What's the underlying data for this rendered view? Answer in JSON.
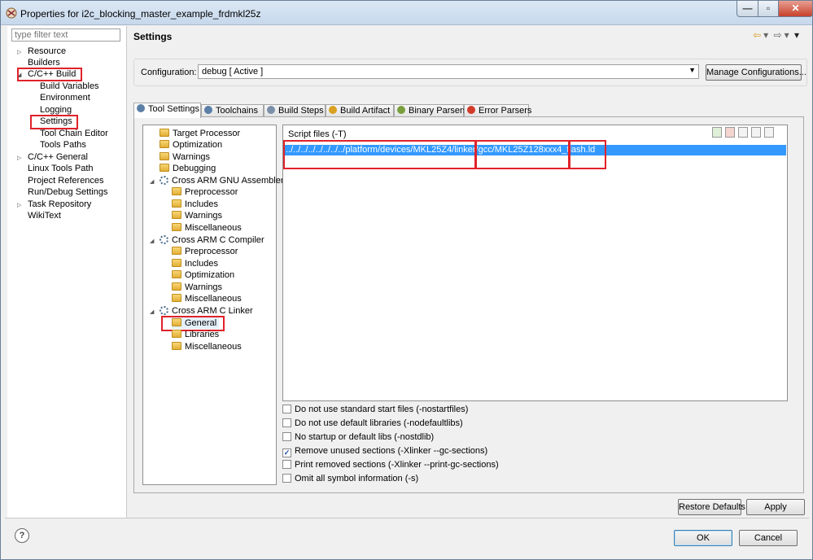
{
  "window": {
    "title": "Properties for i2c_blocking_master_example_frdmkl25z",
    "min": "—",
    "max": "▫",
    "close": "✕"
  },
  "filter": {
    "placeholder": "type filter text"
  },
  "left_tree": {
    "resource": "Resource",
    "builders": "Builders",
    "cpp_build": "C/C++ Build",
    "build_variables": "Build Variables",
    "environment": "Environment",
    "logging": "Logging",
    "settings": "Settings",
    "tool_chain_editor": "Tool Chain Editor",
    "tools_paths": "Tools Paths",
    "cpp_general": "C/C++ General",
    "linux_tools_path": "Linux Tools Path",
    "project_references": "Project References",
    "run_debug_settings": "Run/Debug Settings",
    "task_repository": "Task Repository",
    "wikitext": "WikiText"
  },
  "header": {
    "title": "Settings",
    "back": "⇦",
    "back_menu": "▾",
    "forward": "⇨",
    "forward_menu": "▾",
    "view_menu": "▾"
  },
  "configuration": {
    "label": "Configuration:",
    "value": "debug  [ Active ]",
    "manage_button": "Manage Configurations..."
  },
  "tabs": [
    {
      "label": "Tool Settings",
      "color": "#5b7fa6"
    },
    {
      "label": "Toolchains",
      "color": "#5b7fa6"
    },
    {
      "label": "Build Steps",
      "color": "#7c8fa8"
    },
    {
      "label": "Build Artifact",
      "color": "#d9a021"
    },
    {
      "label": "Binary Parsers",
      "color": "#7b9e3c"
    },
    {
      "label": "Error Parsers",
      "color": "#d23b2a"
    }
  ],
  "tool_tree": {
    "target_processor": "Target Processor",
    "optimization": "Optimization",
    "warnings": "Warnings",
    "debugging": "Debugging",
    "assembler": "Cross ARM GNU Assembler",
    "asm_preprocessor": "Preprocessor",
    "asm_includes": "Includes",
    "asm_warnings": "Warnings",
    "asm_misc": "Miscellaneous",
    "compiler": "Cross ARM C Compiler",
    "cc_preprocessor": "Preprocessor",
    "cc_includes": "Includes",
    "cc_optimization": "Optimization",
    "cc_warnings": "Warnings",
    "cc_misc": "Miscellaneous",
    "linker": "Cross ARM C Linker",
    "ld_general": "General",
    "ld_libraries": "Libraries",
    "ld_misc": "Miscellaneous"
  },
  "script_files": {
    "label": "Script files (-T)",
    "entry_path": "../../../../../../../../platform/devices/MKL25Z4/linker/gcc/",
    "entry_file": "MKL25Z128xxx4_flash.ld"
  },
  "options": [
    {
      "label": "Do not use standard start files (-nostartfiles)",
      "checked": ""
    },
    {
      "label": "Do not use default libraries (-nodefaultlibs)",
      "checked": ""
    },
    {
      "label": "No startup or default libs (-nostdlib)",
      "checked": ""
    },
    {
      "label": "Remove unused sections (-Xlinker --gc-sections)",
      "checked": "✓"
    },
    {
      "label": "Print removed sections (-Xlinker --print-gc-sections)",
      "checked": ""
    },
    {
      "label": "Omit all symbol information (-s)",
      "checked": ""
    }
  ],
  "buttons": {
    "restore_defaults": "Restore Defaults",
    "apply": "Apply",
    "ok": "OK",
    "cancel": "Cancel",
    "help": "?"
  }
}
